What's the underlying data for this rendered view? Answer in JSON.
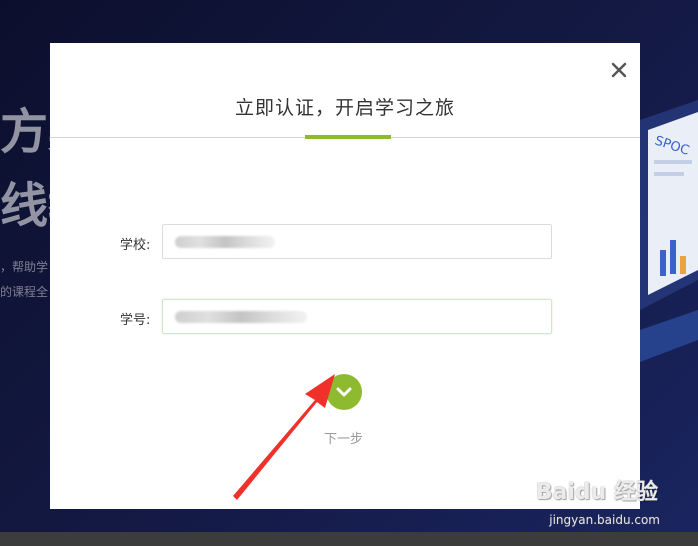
{
  "background": {
    "headline_line1": "方案",
    "headline_line2": "线教",
    "text_line1": "，帮助学",
    "text_line2": "的课程全",
    "illustration_label": "SPOC"
  },
  "modal": {
    "title": "立即认证，开启学习之旅",
    "close_icon": "close-icon",
    "fields": {
      "school_label": "学校:",
      "school_value": "",
      "student_id_label": "学号:",
      "student_id_value": ""
    },
    "next_label": "下一步",
    "next_icon": "chevron-down-icon"
  },
  "watermark": {
    "brand": "Baidu 经验",
    "url": "jingyan.baidu.com"
  },
  "colors": {
    "accent": "#8dba2e",
    "annotation_arrow": "#f0302a",
    "backdrop": "#0d1030"
  }
}
